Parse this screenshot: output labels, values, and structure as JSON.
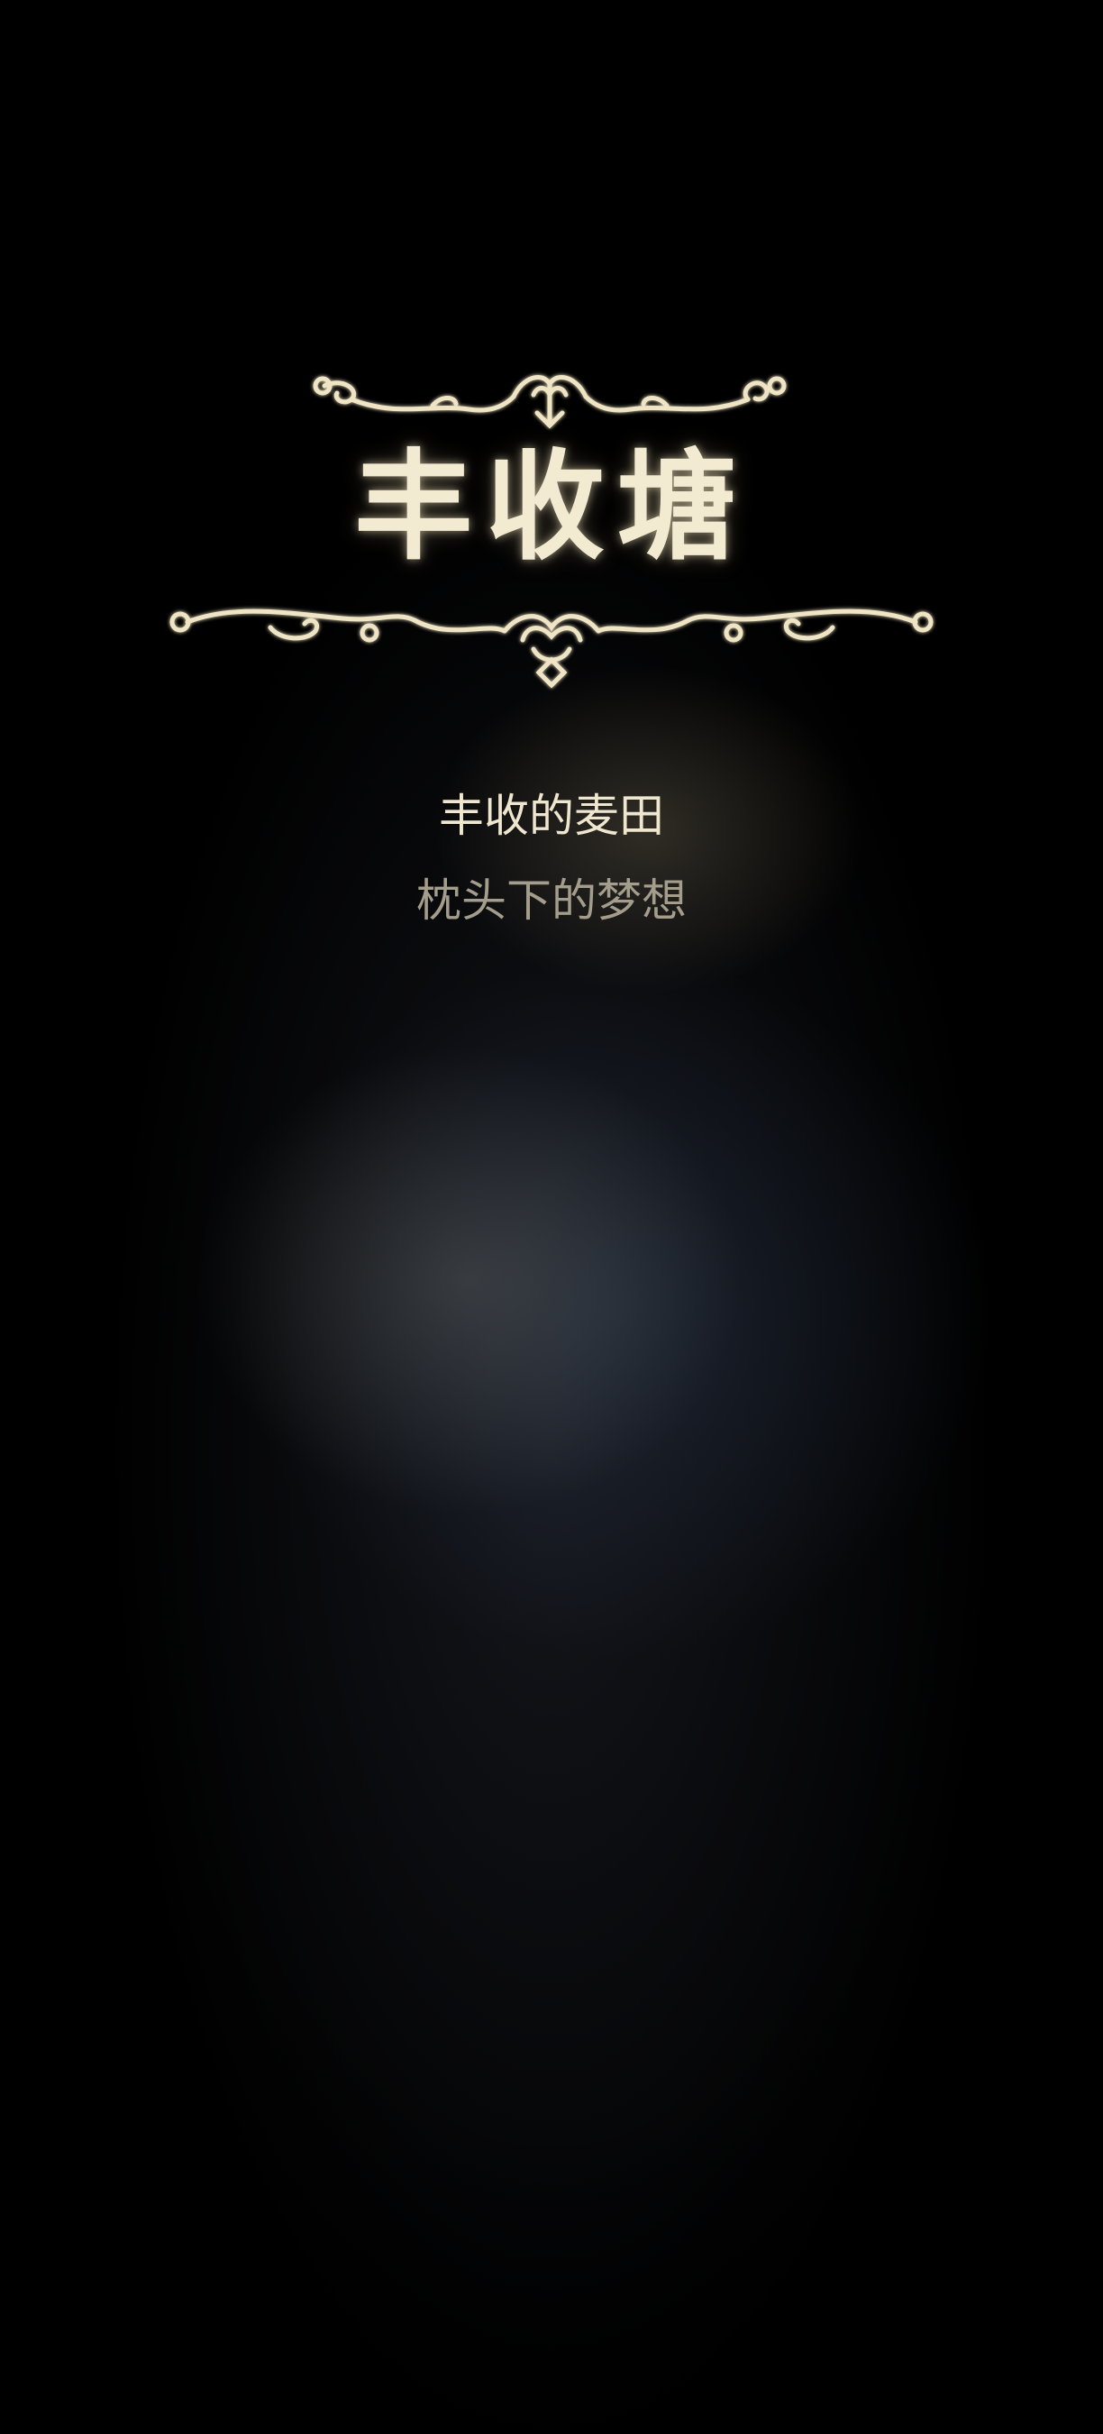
{
  "area": {
    "title": "丰收塘",
    "locations": [
      {
        "label": "丰收的麦田"
      },
      {
        "label": "枕头下的梦想"
      }
    ]
  },
  "colors": {
    "title": "#f3ead2",
    "ornament": "#efe4c4",
    "primary_text": "#efe6cf",
    "secondary_text": "#a49d8b",
    "background": "#000000"
  },
  "icons": {
    "top_ornament": "scroll-flourish-icon",
    "bottom_ornament": "scroll-flourish-icon"
  }
}
